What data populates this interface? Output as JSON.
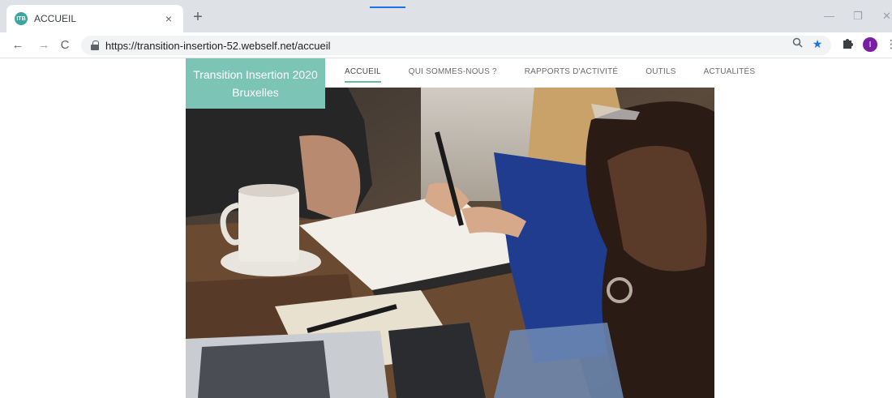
{
  "browser": {
    "tab": {
      "title": "ACCUEIL",
      "favicon_text": "ITB",
      "close": "×"
    },
    "new_tab": "+",
    "window_controls": {
      "minimize": "—",
      "restore": "❐",
      "close": "✕"
    },
    "nav": {
      "back": "←",
      "forward": "→",
      "reload": "C"
    },
    "address_bar": {
      "host": "https://transition-insertion-52.webself.net",
      "path": "/accueil"
    },
    "profile_initial": "I",
    "icons": {
      "zoom": "search-icon",
      "bookmark": "star-icon",
      "extensions": "puzzle-icon",
      "menu": "kebab-icon"
    }
  },
  "site": {
    "logo": {
      "line1": "Transition Insertion 2020",
      "line2": "Bruxelles"
    },
    "nav": [
      {
        "label": "ACCUEIL",
        "active": true
      },
      {
        "label": "QUI SOMMES-NOUS ?"
      },
      {
        "label": "RAPPORTS D'ACTIVITÉ"
      },
      {
        "label": "OUTILS"
      },
      {
        "label": "ACTUALITÉS"
      }
    ],
    "colors": {
      "accent": "#7cc4b5",
      "underline": "#6fb8a8"
    }
  }
}
